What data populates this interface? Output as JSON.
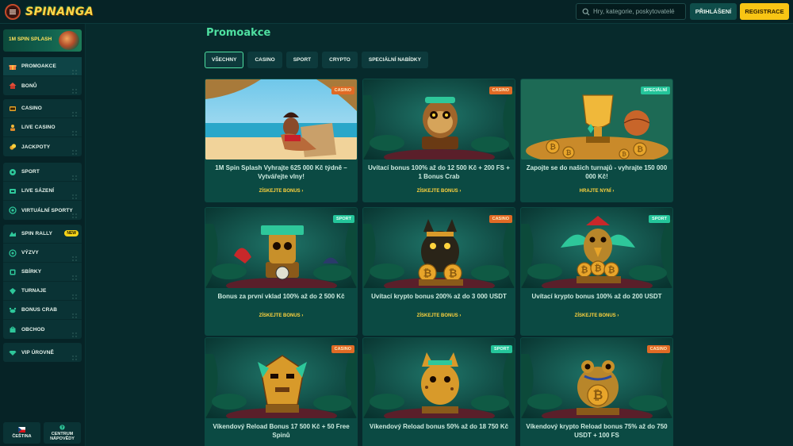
{
  "header": {
    "logo_text": "SPINANGA",
    "search_placeholder": "Hry, kategorie, poskytovatelé",
    "login_label": "PŘIHLÁŠENÍ",
    "register_label": "REGISTRACE"
  },
  "sidebar": {
    "promo_banner": "1M SPIN SPLASH",
    "groups": [
      [
        {
          "label": "PROMOAKCE",
          "icon": "gift-icon",
          "active": true
        },
        {
          "label": "BONŮ",
          "icon": "house-icon"
        }
      ],
      [
        {
          "label": "CASINO",
          "icon": "slot-icon"
        },
        {
          "label": "LIVE CASINO",
          "icon": "dealer-icon"
        },
        {
          "label": "JACKPOTY",
          "icon": "coins-icon"
        }
      ],
      [
        {
          "label": "SPORT",
          "icon": "ball-icon"
        },
        {
          "label": "LIVE SÁZENÍ",
          "icon": "live-icon"
        },
        {
          "label": "VIRTUÁLNÍ SPORTY",
          "icon": "virtual-icon"
        }
      ],
      [
        {
          "label": "SPIN RALLY",
          "icon": "rally-icon",
          "badge": "NEW"
        },
        {
          "label": "VÝZVY",
          "icon": "target-icon"
        },
        {
          "label": "SBÍRKY",
          "icon": "collection-icon"
        },
        {
          "label": "TURNAJE",
          "icon": "tournament-icon"
        },
        {
          "label": "BONUS CRAB",
          "icon": "crab-icon"
        },
        {
          "label": "OBCHOD",
          "icon": "shop-icon"
        }
      ],
      [
        {
          "label": "VIP ÚROVNĚ",
          "icon": "diamond-icon"
        }
      ]
    ],
    "language_label": "ČEŠTINA",
    "help_label": "CENTRUM NÁPOVĚDY"
  },
  "main": {
    "title": "Promoakce",
    "tabs": [
      "VŠECHNY",
      "CASINO",
      "SPORT",
      "CRYPTO",
      "SPECIÁLNÍ NABÍDKY"
    ],
    "active_tab": "VŠECHNY",
    "cards": [
      {
        "tag": "CASINO",
        "tag_type": "casino",
        "title": "1M Spin Splash Vyhrajte 625 000 Kč týdně – Vytvářejte vlny!",
        "cta": "ZÍSKEJTE BONUS",
        "art": "beach"
      },
      {
        "tag": "CASINO",
        "tag_type": "casino",
        "title": "Uvítací bonus 100% až do 12 500 Kč + 200 FS + 1 Bonus Crab",
        "cta": "ZÍSKEJTE BONUS",
        "art": "monkey"
      },
      {
        "tag": "SPECIÁLNÍ",
        "tag_type": "special",
        "title": "Zapojte se do našich turnajů - vyhrajte 150 000 000 Kč!",
        "cta": "HRAJTE NYNÍ",
        "art": "trophy"
      },
      {
        "tag": "SPORT",
        "tag_type": "sport",
        "title": "Bonus za první vklad 100% až do 2 500 Kč",
        "cta": "ZÍSKEJTE BONUS",
        "art": "totem"
      },
      {
        "tag": "CASINO",
        "tag_type": "casino",
        "title": "Uvítací krypto bonus 200% až do 3 000 USDT",
        "cta": "ZÍSKEJTE BONUS",
        "art": "panther"
      },
      {
        "tag": "SPORT",
        "tag_type": "sport",
        "title": "Uvítací krypto bonus 100% až do 200 USDT",
        "cta": "ZÍSKEJTE BONUS",
        "art": "parrot"
      },
      {
        "tag": "CASINO",
        "tag_type": "casino",
        "title": "Víkendový Reload Bonus 17 500 Kč + 50 Free Spinů",
        "cta": "",
        "art": "mask"
      },
      {
        "tag": "SPORT",
        "tag_type": "sport",
        "title": "Víkendový Reload bonus 50% až do 18 750 Kč",
        "cta": "",
        "art": "jaguar"
      },
      {
        "tag": "CASINO",
        "tag_type": "casino",
        "title": "Víkendový krypto Reload bonus 75% až do 750 USDT + 100 FS",
        "cta": "",
        "art": "frog"
      }
    ]
  },
  "colors": {
    "accent": "#4fe0a1",
    "cta_yellow": "#ffd33d",
    "casino_tag": "#e06a25",
    "sport_tag": "#24c59a",
    "register_button": "#f8c514"
  }
}
